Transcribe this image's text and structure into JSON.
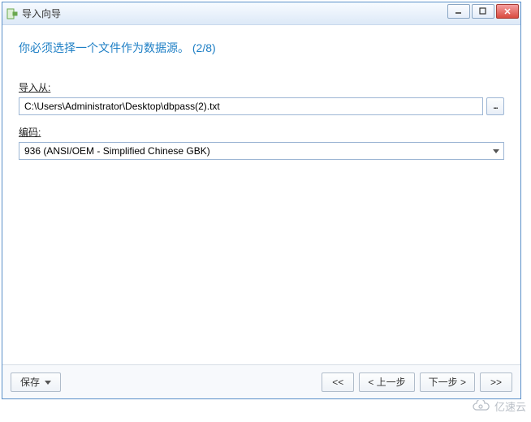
{
  "window": {
    "title": "导入向导"
  },
  "wizard": {
    "heading": "你必须选择一个文件作为数据源。 (2/8)"
  },
  "fields": {
    "import_from": {
      "label": "导入从:",
      "value": "C:\\Users\\Administrator\\Desktop\\dbpass(2).txt",
      "browse_label": "..."
    },
    "encoding": {
      "label": "编码:",
      "value": "936 (ANSI/OEM - Simplified Chinese GBK)"
    }
  },
  "footer": {
    "save_label": "保存",
    "first_label": "<<",
    "prev_label": "< 上一步",
    "next_label": "下一步 >",
    "last_label": ">>"
  },
  "watermark": {
    "text": "亿速云"
  }
}
